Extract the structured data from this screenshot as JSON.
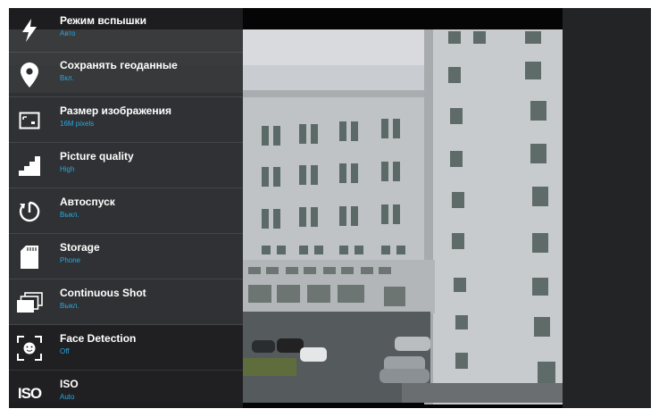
{
  "settings": {
    "items": [
      {
        "title": "Режим вспышки",
        "value": "Авто",
        "icon": "flash-icon"
      },
      {
        "title": "Сохранять геоданные",
        "value": "Вкл.",
        "icon": "location-pin-icon"
      },
      {
        "title": "Размер изображения",
        "value": "16M pixels",
        "icon": "image-size-icon"
      },
      {
        "title": "Picture quality",
        "value": "High",
        "icon": "picture-quality-icon"
      },
      {
        "title": "Автоспуск",
        "value": "Выкл.",
        "icon": "self-timer-icon"
      },
      {
        "title": "Storage",
        "value": "Phone",
        "icon": "sd-card-icon"
      },
      {
        "title": "Continuous Shot",
        "value": "Выкл.",
        "icon": "continuous-shot-icon"
      },
      {
        "title": "Face Detection",
        "value": "Off",
        "icon": "face-detection-icon"
      },
      {
        "title": "ISO",
        "value": "Auto",
        "icon": "iso-icon",
        "icon_text": "ISO"
      }
    ]
  },
  "colors": {
    "accent": "#27a9e1",
    "menu_background": "#232326",
    "right_panel": "#222425"
  }
}
